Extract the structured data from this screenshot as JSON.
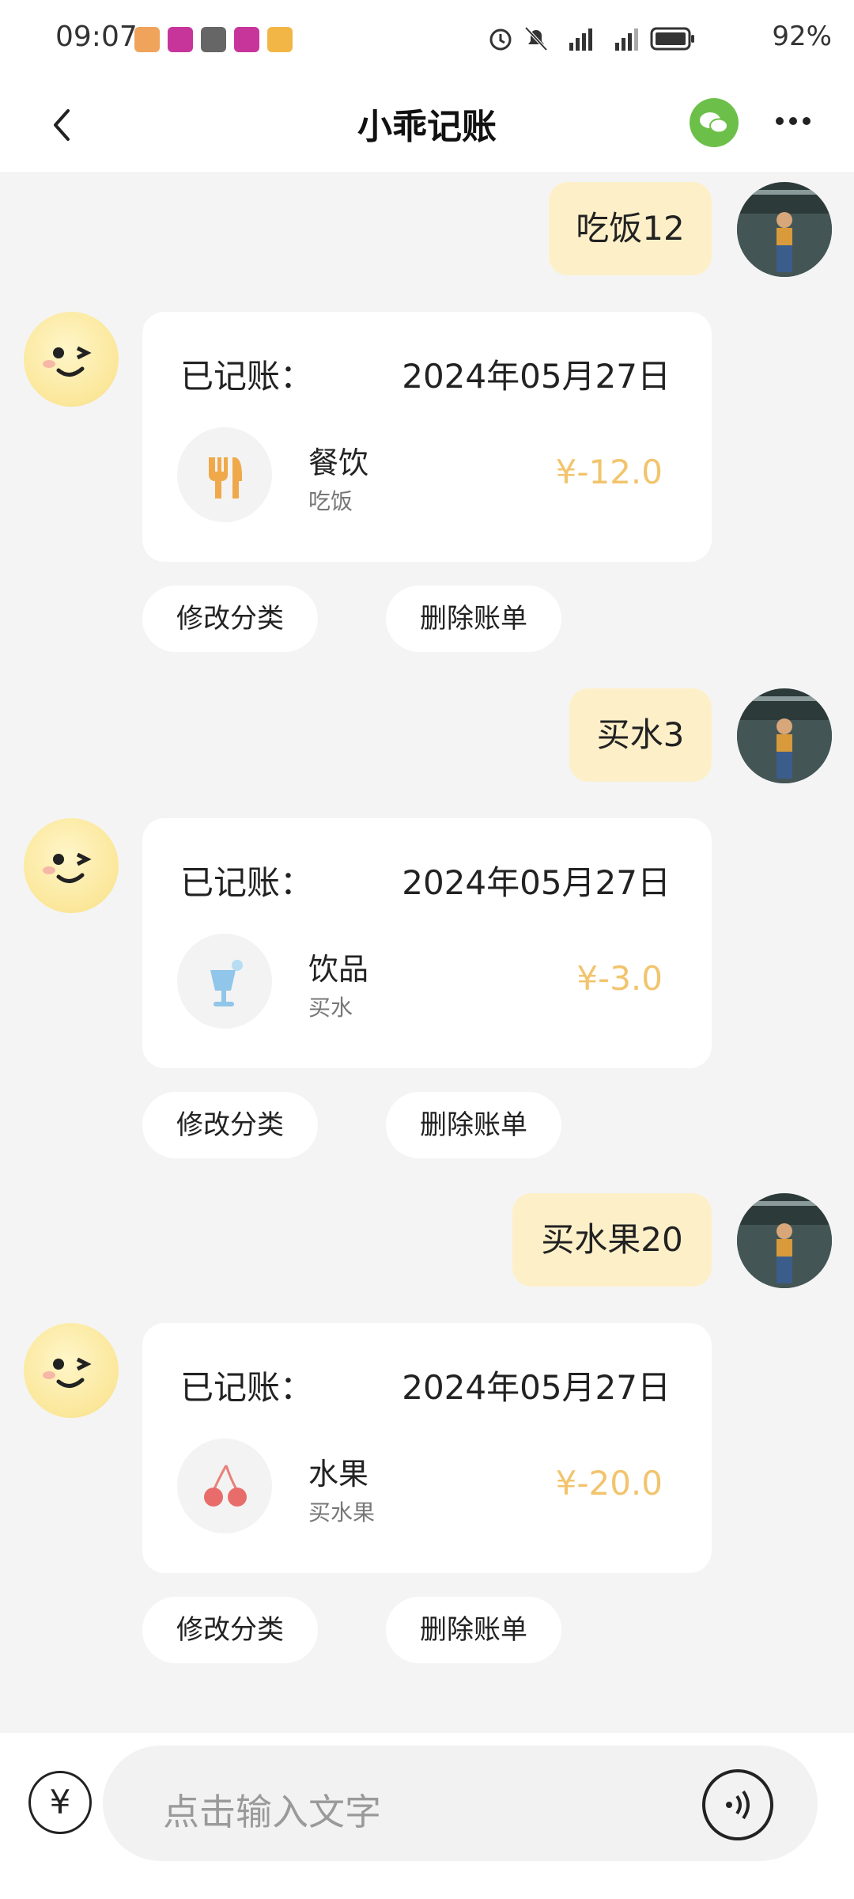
{
  "status_bar": {
    "time": "09:07",
    "battery": "92%"
  },
  "header": {
    "title": "小乖记账"
  },
  "messages": [
    {
      "user_text": "吃饭12",
      "card": {
        "heading": "已记账：",
        "date": "2024年05月27日",
        "category": "餐饮",
        "note": "吃饭",
        "amount": "¥-12.0",
        "icon": "fork-knife-icon"
      },
      "actions": {
        "edit": "修改分类",
        "delete": "删除账单"
      }
    },
    {
      "user_text": "买水3",
      "card": {
        "heading": "已记账：",
        "date": "2024年05月27日",
        "category": "饮品",
        "note": "买水",
        "amount": "¥-3.0",
        "icon": "drink-icon"
      },
      "actions": {
        "edit": "修改分类",
        "delete": "删除账单"
      }
    },
    {
      "user_text": "买水果20",
      "card": {
        "heading": "已记账：",
        "date": "2024年05月27日",
        "category": "水果",
        "note": "买水果",
        "amount": "¥-20.0",
        "icon": "cherry-icon"
      },
      "actions": {
        "edit": "修改分类",
        "delete": "删除账单"
      }
    }
  ],
  "input": {
    "placeholder": "点击输入文字",
    "yen_symbol": "¥"
  },
  "colors": {
    "accent_amount": "#f2c46d",
    "user_bubble": "#fdf0c9",
    "wechat_green": "#6cc04a"
  }
}
